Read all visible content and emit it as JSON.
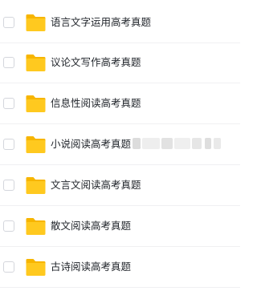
{
  "file_list": {
    "items": [
      {
        "name": "语言文字运用高考真题",
        "icon": "folder-icon"
      },
      {
        "name": "议论文写作高考真题",
        "icon": "folder-icon"
      },
      {
        "name": "信息性阅读高考真题",
        "icon": "folder-icon"
      },
      {
        "name": "小说阅读高考真题【",
        "icon": "folder-icon",
        "redacted_suffix": true
      },
      {
        "name": "文言文阅读高考真题",
        "icon": "folder-icon"
      },
      {
        "name": "散文阅读高考真题",
        "icon": "folder-icon"
      },
      {
        "name": "古诗阅读高考真题",
        "icon": "folder-icon"
      }
    ]
  },
  "colors": {
    "folder_back": "#f7b500",
    "folder_front": "#ffc91f",
    "text": "#1f2329",
    "divider": "#f0f0f2",
    "checkbox_border": "#d4d6dc"
  }
}
